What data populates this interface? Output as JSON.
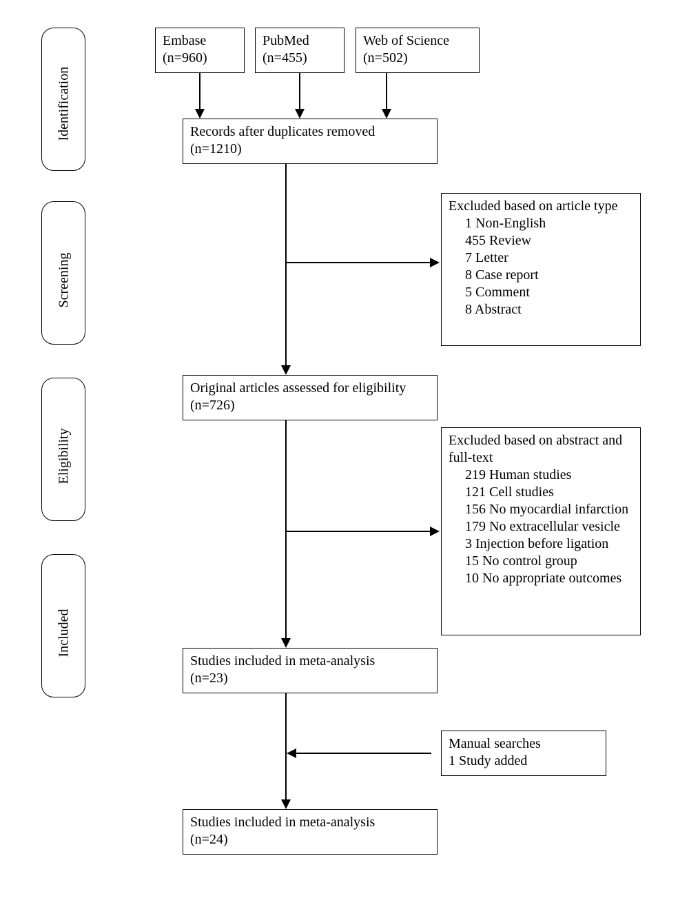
{
  "stages": {
    "identification": "Identification",
    "screening": "Screening",
    "eligibility": "Eligibility",
    "included": "Included"
  },
  "sources": {
    "embase": {
      "name": "Embase",
      "n": "(n=960)"
    },
    "pubmed": {
      "name": "PubMed",
      "n": "(n=455)"
    },
    "wos": {
      "name": "Web of Science",
      "n": "(n=502)"
    }
  },
  "dedup": {
    "label": "Records after duplicates removed",
    "n": "(n=1210)"
  },
  "excl_type": {
    "title": "Excluded based on article type",
    "items": [
      "1 Non-English",
      "455 Review",
      "7 Letter",
      "8 Case report",
      "5 Comment",
      "8 Abstract"
    ]
  },
  "eligible": {
    "label": "Original articles assessed for eligibility (n=726)"
  },
  "excl_full": {
    "title": "Excluded based on abstract and full-text",
    "items": [
      "219 Human studies",
      "121 Cell studies",
      "156 No myocardial infarction",
      "179 No extracellular vesicle",
      "3 Injection before ligation",
      "15 No control group",
      "10 No appropriate outcomes"
    ]
  },
  "included1": {
    "label": "Studies included in meta-analysis",
    "n": "(n=23)"
  },
  "manual": {
    "line1": "Manual searches",
    "line2": "1 Study added"
  },
  "included2": {
    "label": "Studies included in meta-analysis",
    "n": "(n=24)"
  }
}
